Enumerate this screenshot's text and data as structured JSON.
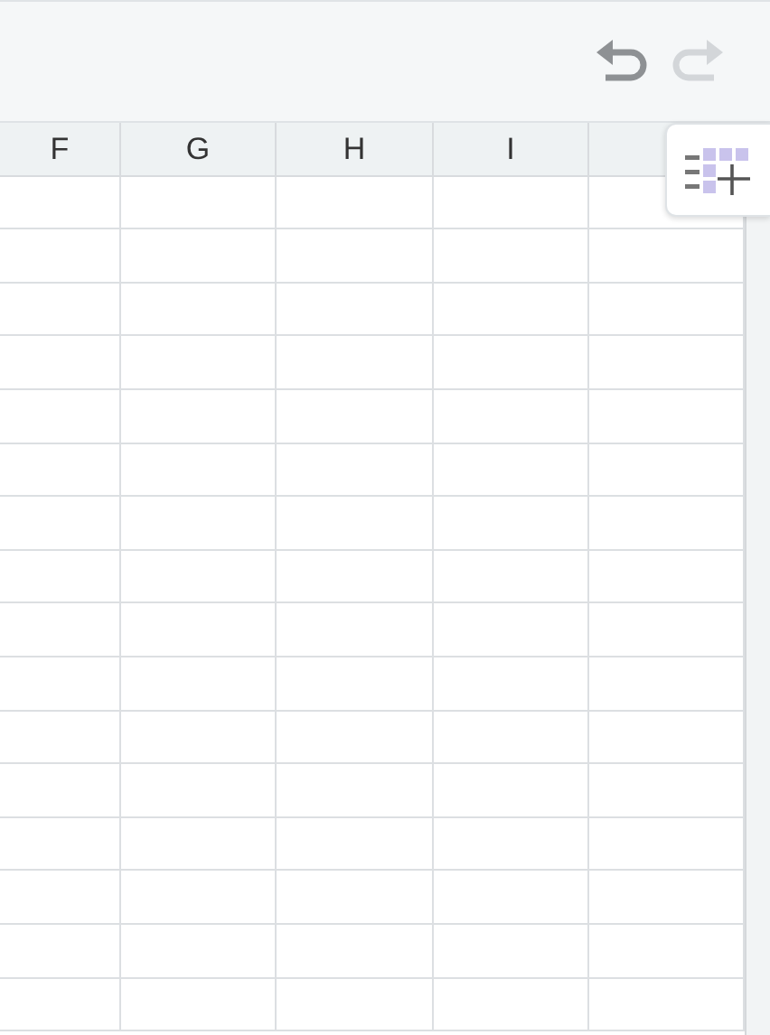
{
  "toolbar": {
    "undo": {
      "disabled": false
    },
    "redo": {
      "disabled": true
    }
  },
  "columns": [
    {
      "label": "F"
    },
    {
      "label": "G"
    },
    {
      "label": "H"
    },
    {
      "label": "I"
    }
  ]
}
